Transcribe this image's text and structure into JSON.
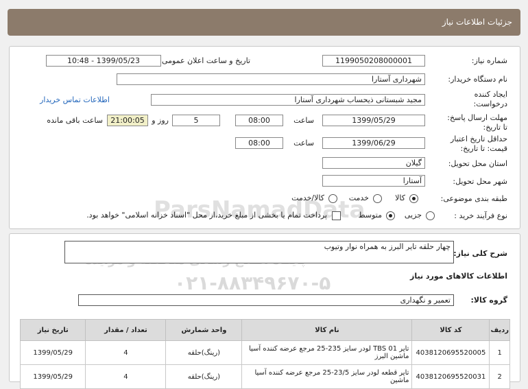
{
  "header": {
    "title": "جزئیات اطلاعات نیاز"
  },
  "watermark": {
    "line1": "ParsNamadData",
    "line2": "پایگاه اطلاع رسانی مناقصه و مزایده",
    "line3": "۰۲۱-۸۸۳۴۹۶۷۰-۵"
  },
  "form": {
    "need_number_label": "شماره نیاز:",
    "need_number": "1199050208000001",
    "announce_label": "تاریخ و ساعت اعلان عمومی:",
    "announce_value": "1399/05/23 - 10:48",
    "buyer_label": "نام دستگاه خریدار:",
    "buyer": "شهرداری آستارا",
    "creator_label_1": "ایجاد کننده",
    "creator_label_2": "درخواست:",
    "creator": "مجید شبستانی ذیحساب شهرداری آستارا",
    "contact_link": "اطلاعات تماس خریدار",
    "deadline_label_1": "مهلت ارسال پاسخ:",
    "deadline_label_2": "تا تاریخ:",
    "deadline_date": "1399/05/29",
    "time_label": "ساعت",
    "deadline_time": "08:00",
    "days": "5",
    "days_label": "روز و",
    "remaining": "21:00:05",
    "remaining_label": "ساعت باقی مانده",
    "validity_label_1": "حداقل تاریخ اعتبار",
    "validity_label_2": "قیمت: تا تاریخ:",
    "validity_date": "1399/06/29",
    "validity_time_label": "ساعت",
    "validity_time": "08:00",
    "province_label": "استان محل تحویل:",
    "province": "گیلان",
    "city_label": "شهر محل تحویل:",
    "city": "آستارا",
    "category_label": "طبقه بندی موضوعی:",
    "cat_goods": "کالا",
    "cat_service": "خدمت",
    "cat_both": "کالا/خدمت",
    "process_label": "نوع فرآیند خرید :",
    "proc_partial": "جزیی",
    "proc_medium": "متوسط",
    "payment_note": "پرداخت تمام یا بخشی از مبلغ خرید،از محل \"اسناد خزانه اسلامی\" خواهد بود."
  },
  "details": {
    "desc_label": "شرح کلی نیاز:",
    "desc": "چهار حلقه تایر البرز به همراه نوار وتیوب",
    "goods_info_title": "اطلاعات کالاهای مورد نیاز",
    "group_label": "گروه کالا:",
    "group": "تعمیر و نگهداری",
    "columns": [
      "ردیف",
      "کد کالا",
      "نام کالا",
      "واحد شمارش",
      "تعداد / مقدار",
      "تاریخ نیاز"
    ],
    "rows": [
      {
        "idx": "1",
        "code": "4038120695520005",
        "name": "تایر TBS 01 لودر سایز 235-25 مرجع عرضه کننده آسیا ماشین البرز",
        "unit": "(رینگ)حلقه",
        "qty": "4",
        "date": "1399/05/29"
      },
      {
        "idx": "2",
        "code": "4038120695520031",
        "name": "تایر قطعه لودر سایز 23/5-25 مرجع عرضه کننده آسیا ماشین",
        "unit": "(رینگ)حلقه",
        "qty": "4",
        "date": "1399/05/29"
      }
    ]
  }
}
